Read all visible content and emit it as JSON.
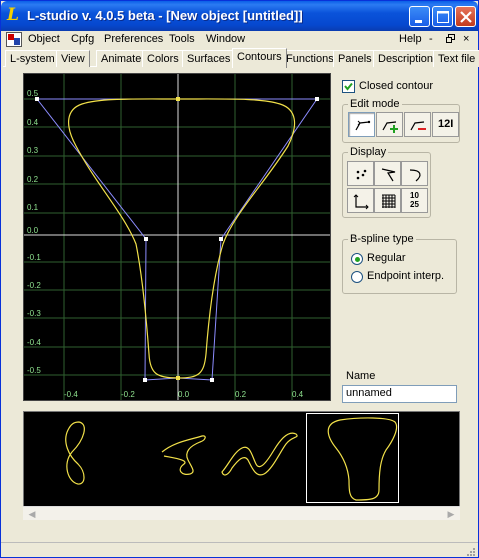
{
  "window": {
    "title": "L-studio v. 4.0.5 beta - [New object [untitled]]",
    "app_icon_letter": "L"
  },
  "menu": {
    "items": [
      "Object",
      "Cpfg",
      "Preferences",
      "Tools",
      "Window"
    ],
    "help": "Help",
    "mdi_minimize": "-",
    "mdi_restore": "×",
    "mdi_close": "×"
  },
  "tabs": [
    "L-system",
    "View",
    "Animate",
    "Colors",
    "Surfaces",
    "Contours",
    "Functions",
    "Panels",
    "Description",
    "Text file"
  ],
  "active_tab": "Contours",
  "editor": {
    "x_ticks": [
      "-0.4",
      "-0.2",
      "0.0",
      "0.2",
      "0.4"
    ],
    "y_ticks": [
      "0.5",
      "0.4",
      "0.3",
      "0.2",
      "0.1",
      "0.0",
      "-0.1",
      "-0.2",
      "-0.3",
      "-0.4",
      "-0.5"
    ],
    "grid_color": "#2f5f2f",
    "curve_color": "#f2e14a",
    "control_color": "#8c8cff"
  },
  "options": {
    "closed_contour_label": "Closed contour",
    "closed_contour_checked": true,
    "edit_mode_label": "Edit mode",
    "edit_mode_buttons": [
      "move-point-icon",
      "add-point-icon",
      "delete-point-icon",
      "multiplicity-icon"
    ],
    "edit_mode_last_text": "12I",
    "display_label": "Display",
    "display_buttons": [
      "points-icon",
      "control-polygon-icon",
      "curve-icon",
      "axes-icon",
      "grid-icon",
      "labels-icon"
    ],
    "labels_text_top": "10",
    "labels_text_bottom": "25",
    "bspline_label": "B-spline type",
    "bspline_options": [
      "Regular",
      "Endpoint interp."
    ],
    "bspline_selected": "Regular",
    "name_label": "Name",
    "name_value": "unnamed"
  },
  "gallery": {
    "selected_index": 3,
    "item_count": 4
  },
  "colors": {
    "accent": "#0a53da",
    "canvas_bg": "#000000",
    "panel_bg": "#ece9d8"
  }
}
